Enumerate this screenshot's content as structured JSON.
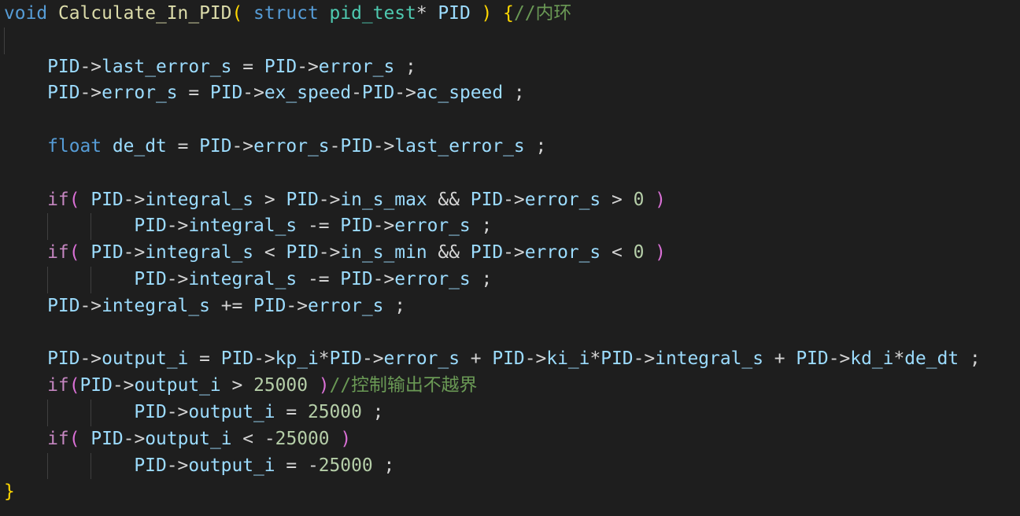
{
  "code": {
    "lines": [
      {
        "indent": 0,
        "guides": [],
        "tokens": [
          [
            "kw",
            "void"
          ],
          [
            "op",
            " "
          ],
          [
            "fn",
            "Calculate_In_PID"
          ],
          [
            "b1",
            "("
          ],
          [
            "op",
            " "
          ],
          [
            "kw",
            "struct"
          ],
          [
            "op",
            " "
          ],
          [
            "ty",
            "pid_test"
          ],
          [
            "op",
            "* "
          ],
          [
            "var",
            "PID"
          ],
          [
            "op",
            " "
          ],
          [
            "b1",
            ")"
          ],
          [
            "op",
            " "
          ],
          [
            "b1",
            "{"
          ],
          [
            "cm",
            "//内环"
          ]
        ]
      },
      {
        "indent": 0,
        "guides": [
          0
        ],
        "tokens": []
      },
      {
        "indent": 4,
        "guides": [],
        "tokens": [
          [
            "var",
            "PID"
          ],
          [
            "op",
            "->"
          ],
          [
            "var",
            "last_error_s"
          ],
          [
            "op",
            " = "
          ],
          [
            "var",
            "PID"
          ],
          [
            "op",
            "->"
          ],
          [
            "var",
            "error_s"
          ],
          [
            "op",
            " ;"
          ]
        ]
      },
      {
        "indent": 4,
        "guides": [],
        "tokens": [
          [
            "var",
            "PID"
          ],
          [
            "op",
            "->"
          ],
          [
            "var",
            "error_s"
          ],
          [
            "op",
            " = "
          ],
          [
            "var",
            "PID"
          ],
          [
            "op",
            "->"
          ],
          [
            "var",
            "ex_speed"
          ],
          [
            "op",
            "-"
          ],
          [
            "var",
            "PID"
          ],
          [
            "op",
            "->"
          ],
          [
            "var",
            "ac_speed"
          ],
          [
            "op",
            " ;"
          ]
        ]
      },
      {
        "indent": 0,
        "guides": [],
        "tokens": []
      },
      {
        "indent": 4,
        "guides": [],
        "tokens": [
          [
            "kw",
            "float"
          ],
          [
            "op",
            " "
          ],
          [
            "var",
            "de_dt"
          ],
          [
            "op",
            " = "
          ],
          [
            "var",
            "PID"
          ],
          [
            "op",
            "->"
          ],
          [
            "var",
            "error_s"
          ],
          [
            "op",
            "-"
          ],
          [
            "var",
            "PID"
          ],
          [
            "op",
            "->"
          ],
          [
            "var",
            "last_error_s"
          ],
          [
            "op",
            " ;"
          ]
        ]
      },
      {
        "indent": 0,
        "guides": [],
        "tokens": []
      },
      {
        "indent": 4,
        "guides": [],
        "tokens": [
          [
            "ctl",
            "if"
          ],
          [
            "b2",
            "("
          ],
          [
            "op",
            " "
          ],
          [
            "var",
            "PID"
          ],
          [
            "op",
            "->"
          ],
          [
            "var",
            "integral_s"
          ],
          [
            "op",
            " > "
          ],
          [
            "var",
            "PID"
          ],
          [
            "op",
            "->"
          ],
          [
            "var",
            "in_s_max"
          ],
          [
            "op",
            " && "
          ],
          [
            "var",
            "PID"
          ],
          [
            "op",
            "->"
          ],
          [
            "var",
            "error_s"
          ],
          [
            "op",
            " > "
          ],
          [
            "num",
            "0"
          ],
          [
            "op",
            " "
          ],
          [
            "b2",
            ")"
          ]
        ]
      },
      {
        "indent": 12,
        "guides": [
          4,
          8
        ],
        "tokens": [
          [
            "var",
            "PID"
          ],
          [
            "op",
            "->"
          ],
          [
            "var",
            "integral_s"
          ],
          [
            "op",
            " -= "
          ],
          [
            "var",
            "PID"
          ],
          [
            "op",
            "->"
          ],
          [
            "var",
            "error_s"
          ],
          [
            "op",
            " ;"
          ]
        ]
      },
      {
        "indent": 4,
        "guides": [],
        "tokens": [
          [
            "ctl",
            "if"
          ],
          [
            "b2",
            "("
          ],
          [
            "op",
            " "
          ],
          [
            "var",
            "PID"
          ],
          [
            "op",
            "->"
          ],
          [
            "var",
            "integral_s"
          ],
          [
            "op",
            " < "
          ],
          [
            "var",
            "PID"
          ],
          [
            "op",
            "->"
          ],
          [
            "var",
            "in_s_min"
          ],
          [
            "op",
            " && "
          ],
          [
            "var",
            "PID"
          ],
          [
            "op",
            "->"
          ],
          [
            "var",
            "error_s"
          ],
          [
            "op",
            " < "
          ],
          [
            "num",
            "0"
          ],
          [
            "op",
            " "
          ],
          [
            "b2",
            ")"
          ]
        ]
      },
      {
        "indent": 12,
        "guides": [
          4,
          8
        ],
        "tokens": [
          [
            "var",
            "PID"
          ],
          [
            "op",
            "->"
          ],
          [
            "var",
            "integral_s"
          ],
          [
            "op",
            " -= "
          ],
          [
            "var",
            "PID"
          ],
          [
            "op",
            "->"
          ],
          [
            "var",
            "error_s"
          ],
          [
            "op",
            " ;"
          ]
        ]
      },
      {
        "indent": 4,
        "guides": [],
        "tokens": [
          [
            "var",
            "PID"
          ],
          [
            "op",
            "->"
          ],
          [
            "var",
            "integral_s"
          ],
          [
            "op",
            " += "
          ],
          [
            "var",
            "PID"
          ],
          [
            "op",
            "->"
          ],
          [
            "var",
            "error_s"
          ],
          [
            "op",
            " ;"
          ]
        ]
      },
      {
        "indent": 0,
        "guides": [],
        "tokens": []
      },
      {
        "indent": 4,
        "guides": [],
        "tokens": [
          [
            "var",
            "PID"
          ],
          [
            "op",
            "->"
          ],
          [
            "var",
            "output_i"
          ],
          [
            "op",
            " = "
          ],
          [
            "var",
            "PID"
          ],
          [
            "op",
            "->"
          ],
          [
            "var",
            "kp_i"
          ],
          [
            "op",
            "*"
          ],
          [
            "var",
            "PID"
          ],
          [
            "op",
            "->"
          ],
          [
            "var",
            "error_s"
          ],
          [
            "op",
            " + "
          ],
          [
            "var",
            "PID"
          ],
          [
            "op",
            "->"
          ],
          [
            "var",
            "ki_i"
          ],
          [
            "op",
            "*"
          ],
          [
            "var",
            "PID"
          ],
          [
            "op",
            "->"
          ],
          [
            "var",
            "integral_s"
          ],
          [
            "op",
            " + "
          ],
          [
            "var",
            "PID"
          ],
          [
            "op",
            "->"
          ],
          [
            "var",
            "kd_i"
          ],
          [
            "op",
            "*"
          ],
          [
            "var",
            "de_dt"
          ],
          [
            "op",
            " ;"
          ]
        ]
      },
      {
        "indent": 4,
        "guides": [],
        "tokens": [
          [
            "ctl",
            "if"
          ],
          [
            "b2",
            "("
          ],
          [
            "var",
            "PID"
          ],
          [
            "op",
            "->"
          ],
          [
            "var",
            "output_i"
          ],
          [
            "op",
            " > "
          ],
          [
            "num",
            "25000"
          ],
          [
            "op",
            " "
          ],
          [
            "b2",
            ")"
          ],
          [
            "cm",
            "//控制输出不越界"
          ]
        ]
      },
      {
        "indent": 12,
        "guides": [
          4,
          8
        ],
        "tokens": [
          [
            "var",
            "PID"
          ],
          [
            "op",
            "->"
          ],
          [
            "var",
            "output_i"
          ],
          [
            "op",
            " = "
          ],
          [
            "num",
            "25000"
          ],
          [
            "op",
            " ;"
          ]
        ]
      },
      {
        "indent": 4,
        "guides": [],
        "tokens": [
          [
            "ctl",
            "if"
          ],
          [
            "b2",
            "("
          ],
          [
            "op",
            " "
          ],
          [
            "var",
            "PID"
          ],
          [
            "op",
            "->"
          ],
          [
            "var",
            "output_i"
          ],
          [
            "op",
            " < -"
          ],
          [
            "num",
            "25000"
          ],
          [
            "op",
            " "
          ],
          [
            "b2",
            ")"
          ]
        ]
      },
      {
        "indent": 12,
        "guides": [
          4,
          8
        ],
        "tokens": [
          [
            "var",
            "PID"
          ],
          [
            "op",
            "->"
          ],
          [
            "var",
            "output_i"
          ],
          [
            "op",
            " = -"
          ],
          [
            "num",
            "25000"
          ],
          [
            "op",
            " ;"
          ]
        ]
      },
      {
        "indent": 0,
        "guides": [],
        "tokens": [
          [
            "b1",
            "}"
          ]
        ]
      }
    ]
  }
}
